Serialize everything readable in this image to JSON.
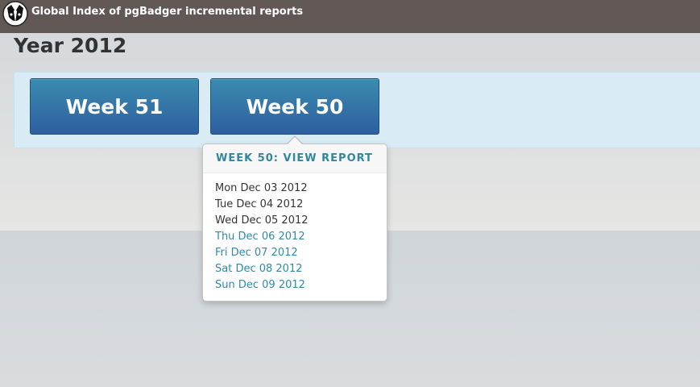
{
  "header": {
    "logo_icon": "badger-icon",
    "title": "Global Index of pgBadger incremental reports"
  },
  "year": {
    "title": "Year 2012"
  },
  "weeks": [
    {
      "label": "Week 51"
    },
    {
      "label": "Week 50"
    }
  ],
  "popover": {
    "title": "WEEK 50: VIEW REPORT",
    "days": [
      {
        "label": "Mon Dec 03 2012",
        "linked": false
      },
      {
        "label": "Tue Dec 04 2012",
        "linked": false
      },
      {
        "label": "Wed Dec 05 2012",
        "linked": false
      },
      {
        "label": "Thu Dec 06 2012",
        "linked": true
      },
      {
        "label": "Fri Dec 07 2012",
        "linked": true
      },
      {
        "label": "Sat Dec 08 2012",
        "linked": true
      },
      {
        "label": "Sun Dec 09 2012",
        "linked": true
      }
    ]
  },
  "colors": {
    "topbar": "#615755",
    "button_top": "#3a8cb0",
    "button_bottom": "#2f5e9f",
    "link": "#2f8aaa",
    "popover_title": "#2f87a2"
  }
}
